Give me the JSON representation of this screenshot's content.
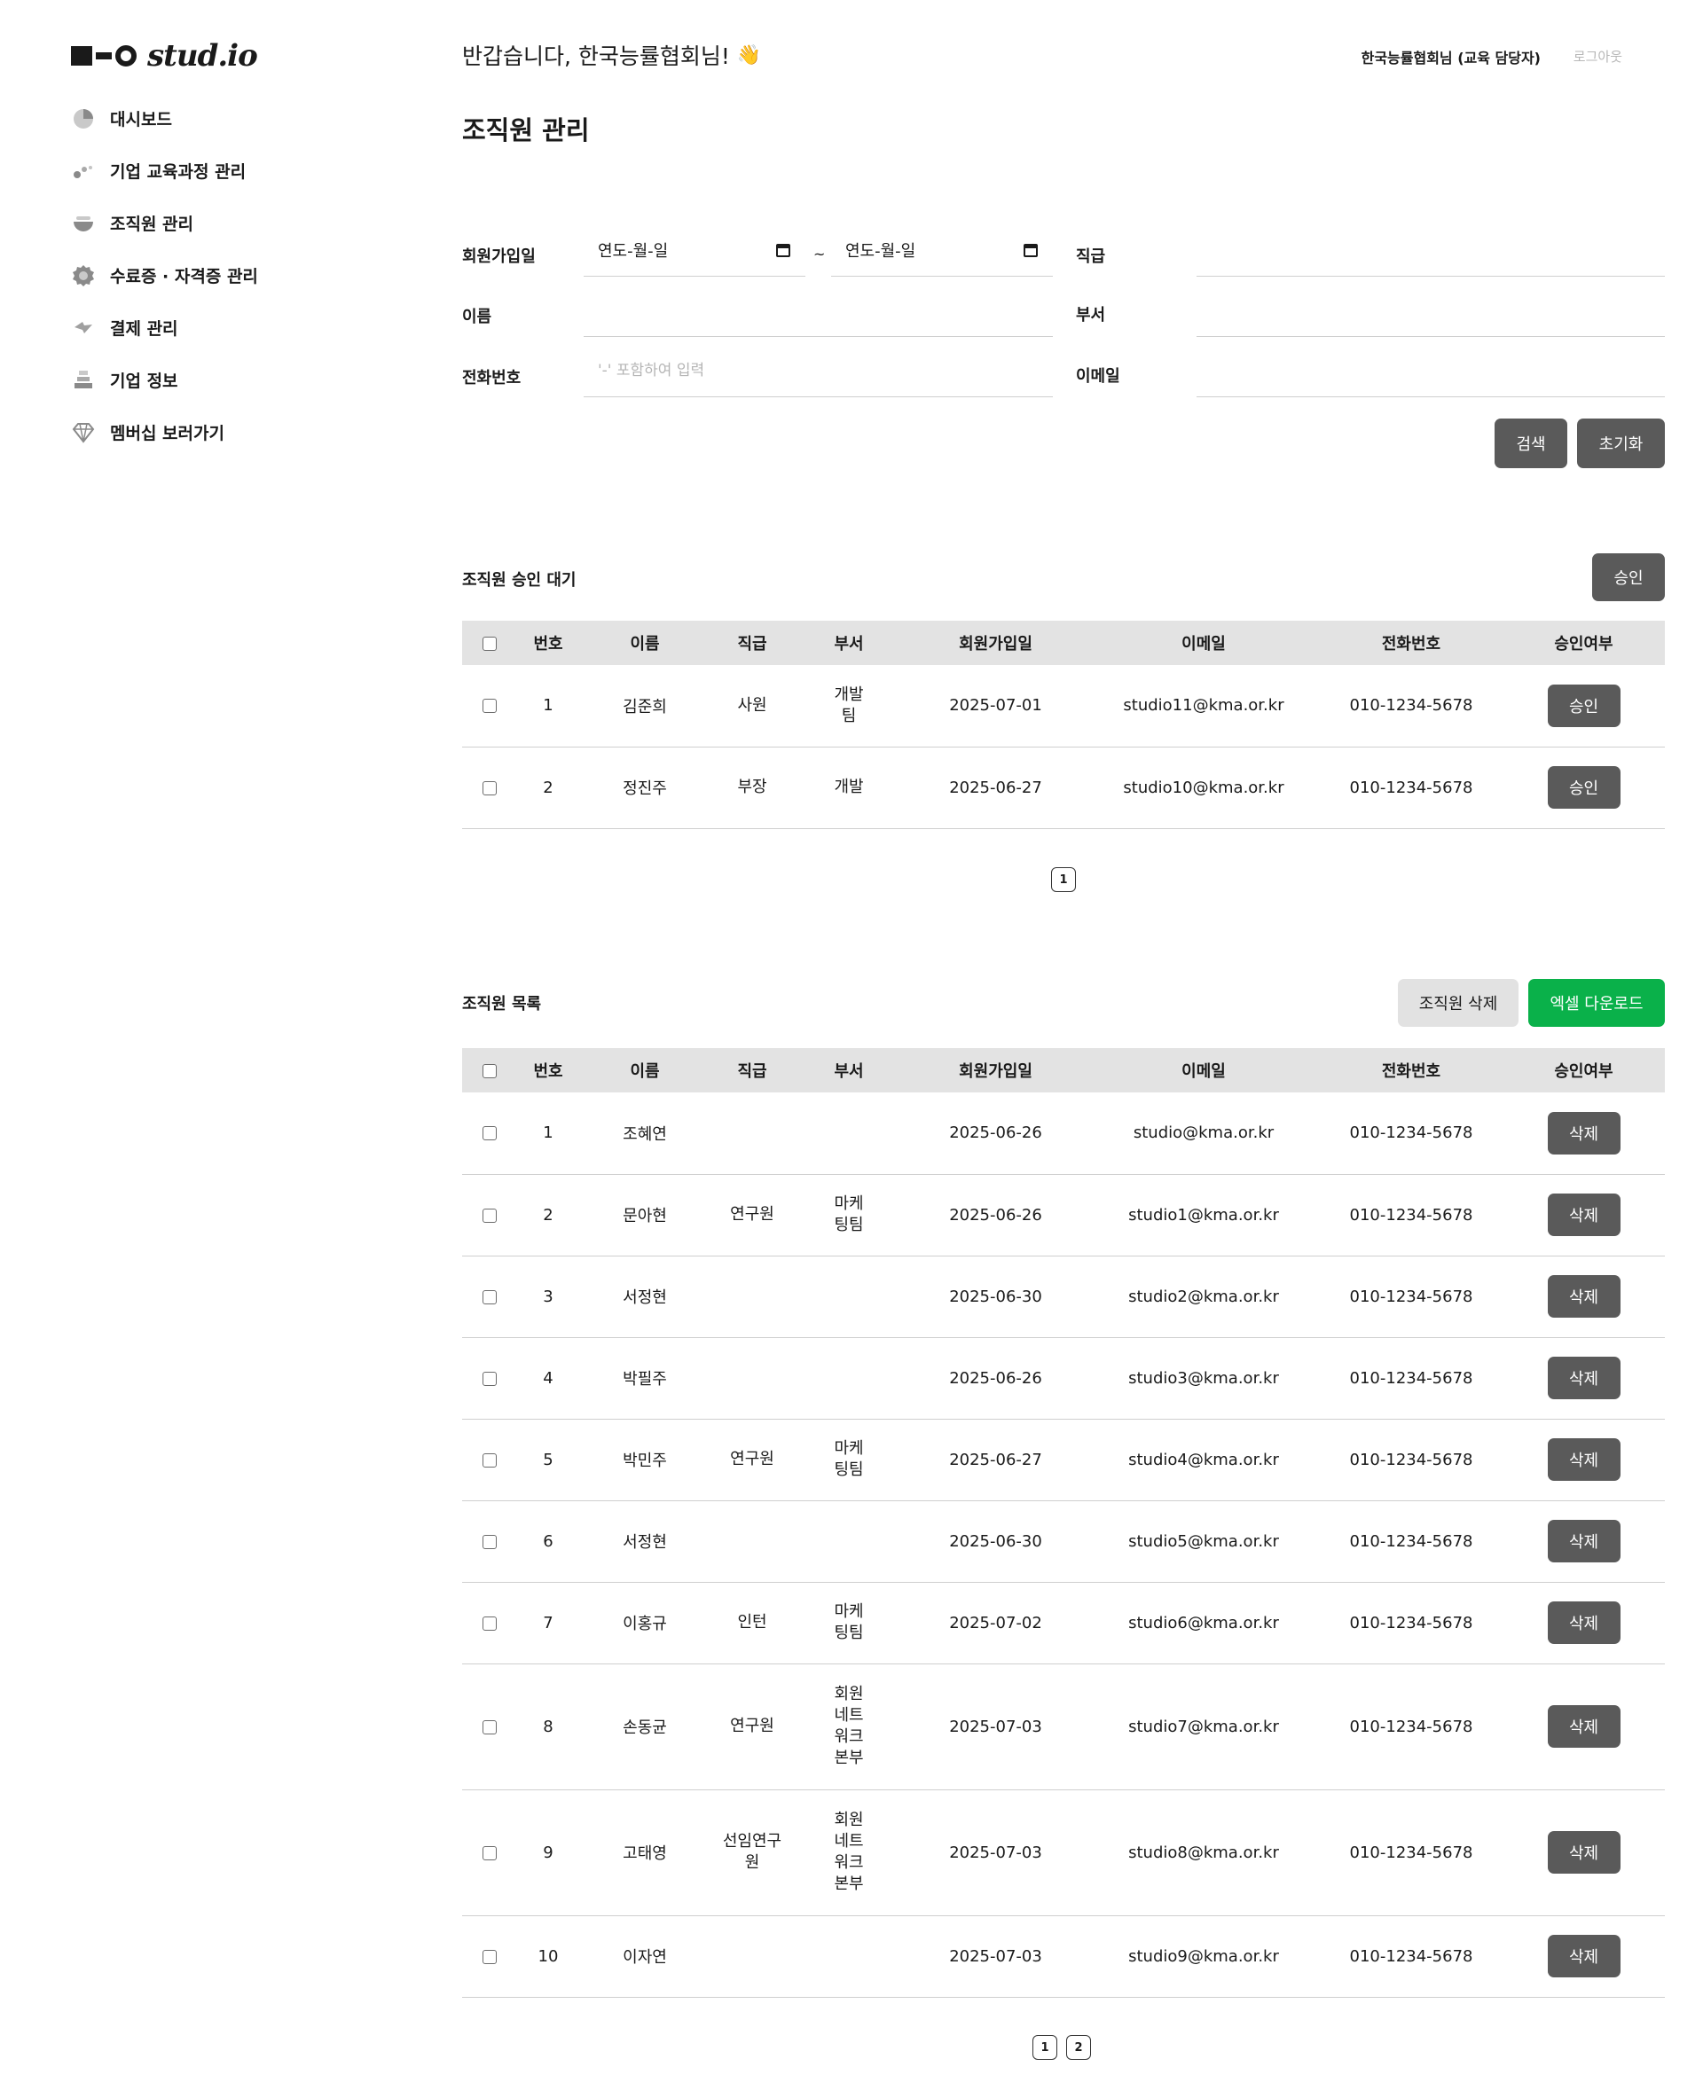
{
  "brand": {
    "logo_text": "stud.io"
  },
  "sidebar": {
    "items": [
      {
        "label": "대시보드",
        "icon": "pie-chart-icon"
      },
      {
        "label": "기업 교육과정 관리",
        "icon": "dots-icon"
      },
      {
        "label": "조직원 관리",
        "icon": "bowl-icon"
      },
      {
        "label": "수료증 · 자격증 관리",
        "icon": "badge-icon"
      },
      {
        "label": "결제 관리",
        "icon": "bolt-icon"
      },
      {
        "label": "기업 정보",
        "icon": "stack-icon"
      },
      {
        "label": "멤버십 보러가기",
        "icon": "diamond-icon"
      }
    ]
  },
  "header": {
    "greeting": "반갑습니다, 한국능률협회님!",
    "wave": "👋",
    "user": "한국능률협회님 (교육 담당자)",
    "logout": "로그아웃"
  },
  "page": {
    "title": "조직원 관리"
  },
  "filter": {
    "join_date_label": "회원가입일",
    "date_from": "연도-월-일",
    "date_to": "연도-월-일",
    "tilde": "~",
    "position_label": "직급",
    "name_label": "이름",
    "dept_label": "부서",
    "phone_label": "전화번호",
    "phone_placeholder": "'-' 포함하여 입력",
    "email_label": "이메일",
    "search_button": "검색",
    "reset_button": "초기화"
  },
  "pending": {
    "title": "조직원 승인 대기",
    "approve_button": "승인",
    "columns": [
      "번호",
      "이름",
      "직급",
      "부서",
      "회원가입일",
      "이메일",
      "전화번호",
      "승인여부"
    ],
    "rows": [
      {
        "no": "1",
        "name": "김준희",
        "position": "사원",
        "dept_lines": [
          "개발",
          "팀"
        ],
        "joined": "2025-07-01",
        "email": "studio11@kma.or.kr",
        "phone": "010-1234-5678",
        "action": "승인"
      },
      {
        "no": "2",
        "name": "정진주",
        "position": "부장",
        "dept_lines": [
          "개발"
        ],
        "joined": "2025-06-27",
        "email": "studio10@kma.or.kr",
        "phone": "010-1234-5678",
        "action": "승인"
      }
    ],
    "pages": [
      "1"
    ]
  },
  "members": {
    "title": "조직원 목록",
    "delete_button": "조직원 삭제",
    "excel_button": "엑셀 다운로드",
    "columns": [
      "번호",
      "이름",
      "직급",
      "부서",
      "회원가입일",
      "이메일",
      "전화번호",
      "승인여부"
    ],
    "rows": [
      {
        "no": "1",
        "name": "조혜연",
        "position": "",
        "dept_lines": [],
        "joined": "2025-06-26",
        "email": "studio@kma.or.kr",
        "phone": "010-1234-5678",
        "action": "삭제"
      },
      {
        "no": "2",
        "name": "문아현",
        "position": "연구원",
        "dept_lines": [
          "마케",
          "팅팀"
        ],
        "joined": "2025-06-26",
        "email": "studio1@kma.or.kr",
        "phone": "010-1234-5678",
        "action": "삭제"
      },
      {
        "no": "3",
        "name": "서정현",
        "position": "",
        "dept_lines": [],
        "joined": "2025-06-30",
        "email": "studio2@kma.or.kr",
        "phone": "010-1234-5678",
        "action": "삭제"
      },
      {
        "no": "4",
        "name": "박필주",
        "position": "",
        "dept_lines": [],
        "joined": "2025-06-26",
        "email": "studio3@kma.or.kr",
        "phone": "010-1234-5678",
        "action": "삭제"
      },
      {
        "no": "5",
        "name": "박민주",
        "position": "연구원",
        "dept_lines": [
          "마케",
          "팅팀"
        ],
        "joined": "2025-06-27",
        "email": "studio4@kma.or.kr",
        "phone": "010-1234-5678",
        "action": "삭제"
      },
      {
        "no": "6",
        "name": "서정현",
        "position": "",
        "dept_lines": [],
        "joined": "2025-06-30",
        "email": "studio5@kma.or.kr",
        "phone": "010-1234-5678",
        "action": "삭제"
      },
      {
        "no": "7",
        "name": "이홍규",
        "position": "인턴",
        "dept_lines": [
          "마케",
          "팅팀"
        ],
        "joined": "2025-07-02",
        "email": "studio6@kma.or.kr",
        "phone": "010-1234-5678",
        "action": "삭제"
      },
      {
        "no": "8",
        "name": "손동균",
        "position": "연구원",
        "dept_lines": [
          "회원",
          "네트",
          "워크",
          "본부"
        ],
        "joined": "2025-07-03",
        "email": "studio7@kma.or.kr",
        "phone": "010-1234-5678",
        "action": "삭제"
      },
      {
        "no": "9",
        "name": "고태영",
        "position": "선임연구\n원",
        "dept_lines": [
          "회원",
          "네트",
          "워크",
          "본부"
        ],
        "joined": "2025-07-03",
        "email": "studio8@kma.or.kr",
        "phone": "010-1234-5678",
        "action": "삭제"
      },
      {
        "no": "10",
        "name": "이자연",
        "position": "",
        "dept_lines": [],
        "joined": "2025-07-03",
        "email": "studio9@kma.or.kr",
        "phone": "010-1234-5678",
        "action": "삭제"
      }
    ],
    "pages": [
      "1",
      "2"
    ]
  }
}
